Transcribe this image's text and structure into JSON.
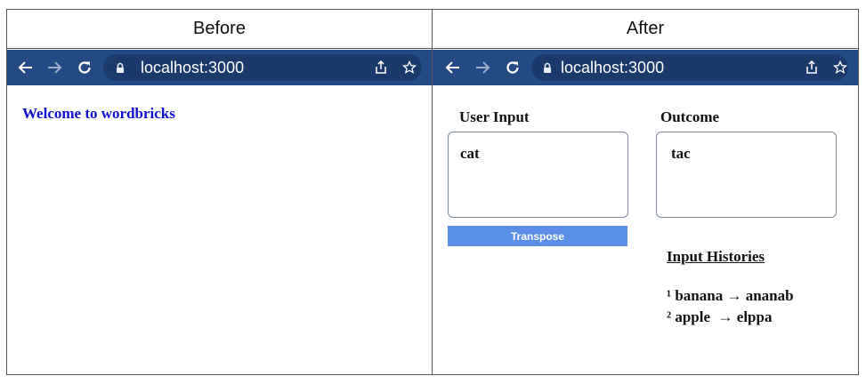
{
  "panels": {
    "before": {
      "title": "Before",
      "browser": {
        "url": "localhost:3000"
      },
      "page": {
        "heading": "Welcome to wordbricks"
      }
    },
    "after": {
      "title": "After",
      "browser": {
        "url": "localhost:3000"
      },
      "page": {
        "user_input_label": "User Input",
        "user_input_value": "cat",
        "outcome_label": "Outcome",
        "outcome_value": "tac",
        "transpose_button": "Transpose",
        "histories_title": "Input Histories",
        "histories": [
          {
            "text": "¹ banana → ananab"
          },
          {
            "text": "² apple  → elppa"
          }
        ]
      }
    }
  },
  "icons": {
    "back": "arrow-left-icon",
    "forward": "arrow-right-icon",
    "reload": "reload-icon",
    "lock": "lock-icon",
    "share": "share-icon",
    "bookmark": "star-icon"
  },
  "colors": {
    "toolbar": "#244a84",
    "omnibox": "#1a3a6b",
    "welcome_text": "#1010d0",
    "button": "#5b8ee6"
  }
}
